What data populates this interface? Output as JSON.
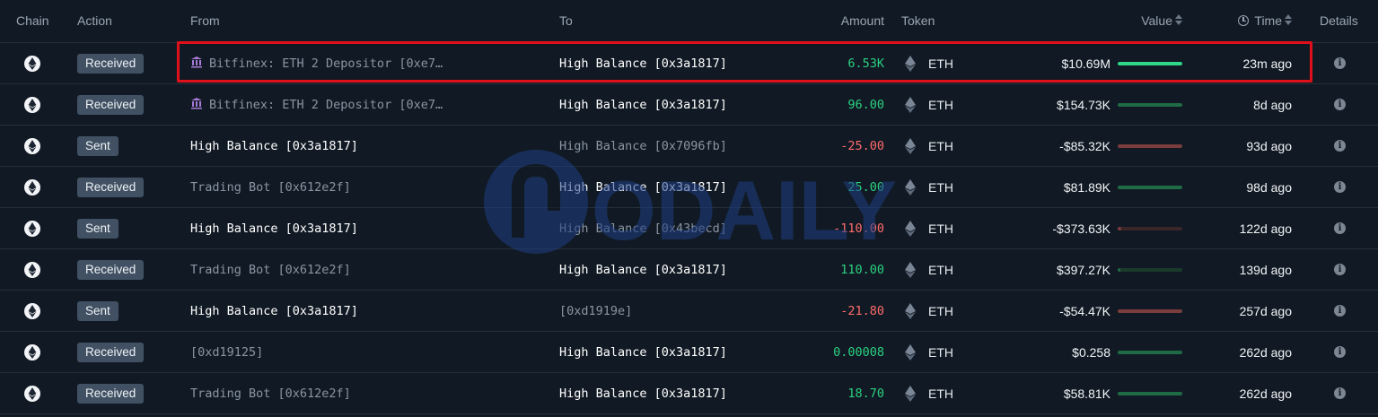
{
  "headers": {
    "chain": "Chain",
    "action": "Action",
    "from": "From",
    "to": "To",
    "amount": "Amount",
    "token": "Token",
    "value": "Value",
    "time": "Time",
    "details": "Details"
  },
  "watermark": "ODAILY",
  "colors": {
    "background": "#111a24",
    "positive": "#2bd180",
    "negative": "#ff6b6b",
    "bar_positive": "#1f6b45",
    "bar_negative": "#7a3c3c",
    "highlight": "#e0101a"
  },
  "rows": [
    {
      "action": "Received",
      "from": "Bitfinex: ETH 2 Depositor [0xe7…",
      "from_icon": "bank-icon",
      "from_style": "dim",
      "to": "High Balance [0x3a1817]",
      "to_style": "bright",
      "amount": "6.53K",
      "sign": "pos",
      "token": "ETH",
      "value": "$10.69M",
      "bar": 1.0,
      "time": "23m ago",
      "highlighted": true
    },
    {
      "action": "Received",
      "from": "Bitfinex: ETH 2 Depositor [0xe7…",
      "from_icon": "bank-icon",
      "from_style": "dim",
      "to": "High Balance [0x3a1817]",
      "to_style": "bright",
      "amount": "96.00",
      "sign": "pos",
      "token": "ETH",
      "value": "$154.73K",
      "bar": 1.0,
      "time": "8d ago"
    },
    {
      "action": "Sent",
      "from": "High Balance [0x3a1817]",
      "from_style": "bright",
      "to": "High Balance [0x7096fb]",
      "to_style": "dim",
      "amount": "-25.00",
      "sign": "neg",
      "token": "ETH",
      "value": "-$85.32K",
      "bar": 1.0,
      "time": "93d ago"
    },
    {
      "action": "Received",
      "from": "Trading Bot [0x612e2f]",
      "from_style": "dim",
      "to": "High Balance [0x3a1817]",
      "to_style": "bright",
      "amount": "25.00",
      "sign": "pos",
      "token": "ETH",
      "value": "$81.89K",
      "bar": 1.0,
      "time": "98d ago"
    },
    {
      "action": "Sent",
      "from": "High Balance [0x3a1817]",
      "from_style": "bright",
      "to": "High Balance [0x43becd]",
      "to_style": "dim",
      "amount": "-110.00",
      "sign": "neg",
      "token": "ETH",
      "value": "-$373.63K",
      "bar": 0.05,
      "time": "122d ago"
    },
    {
      "action": "Received",
      "from": "Trading Bot [0x612e2f]",
      "from_style": "dim",
      "to": "High Balance [0x3a1817]",
      "to_style": "bright",
      "amount": "110.00",
      "sign": "pos",
      "token": "ETH",
      "value": "$397.27K",
      "bar": 0.04,
      "time": "139d ago"
    },
    {
      "action": "Sent",
      "from": "High Balance [0x3a1817]",
      "from_style": "bright",
      "to": "[0xd1919e]",
      "to_style": "dim",
      "amount": "-21.80",
      "sign": "neg",
      "token": "ETH",
      "value": "-$54.47K",
      "bar": 1.0,
      "time": "257d ago"
    },
    {
      "action": "Received",
      "from": "[0xd19125]",
      "from_style": "dim",
      "to": "High Balance [0x3a1817]",
      "to_style": "bright",
      "amount": "0.00008",
      "sign": "pos",
      "token": "ETH",
      "value": "$0.258",
      "bar": 1.0,
      "time": "262d ago"
    },
    {
      "action": "Received",
      "from": "Trading Bot [0x612e2f]",
      "from_style": "dim",
      "to": "High Balance [0x3a1817]",
      "to_style": "bright",
      "amount": "18.70",
      "sign": "pos",
      "token": "ETH",
      "value": "$58.81K",
      "bar": 1.0,
      "time": "262d ago"
    }
  ]
}
